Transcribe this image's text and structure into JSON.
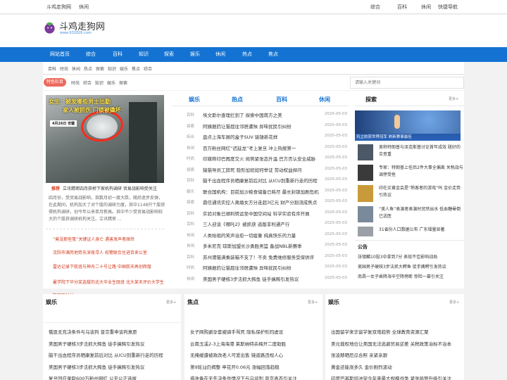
{
  "topbar": {
    "site": "斗鸡走狗网",
    "leisure": "休闲",
    "links": [
      "综合",
      "百科",
      "休闲",
      "快捷导航"
    ]
  },
  "logo": {
    "name": "斗鸡走狗网",
    "url": "www.932826.com"
  },
  "nav": [
    "网站首页",
    "综合",
    "百科",
    "知识",
    "探索",
    "娱乐",
    "休闲",
    "热点",
    "焦点"
  ],
  "subnav": [
    "百科",
    "时尚",
    "休闲",
    "热点",
    "探索",
    "知识",
    "娱乐",
    "焦点",
    "综合"
  ],
  "hot_label": "特色栏目",
  "hot_tags": [
    "时尚",
    "综合",
    "知识",
    "娱乐",
    "探索"
  ],
  "search": {
    "placeholder": "请输入关键词"
  },
  "feature": {
    "image_caption_line1": "女生：被发哪些男士出勤",
    "image_caption_line2": "家人被抓伤 门锁被撬坏",
    "image_date": "4月26日 安徽",
    "rec_label": "推荐",
    "rec_title": "立讯精密四月获桥下家机构调研 贸易战影响受关注",
    "summary": "四月份，受贸易战影响，指数月初一度大跌，随后逐步反弹，在此期间，机构加大了对个股的调研力度，其中1148只个股获得机构调研，创今年以来单月新高。其中不少受贸易战影响较大的个股获调研机构关注。立讯精密 ...",
    "red_links": [
      "“竟没那些冤”关键证人身亡 遇害发声者阐世",
      "沈阳市满芮地势东深夜寻人 校警联合住进百舍公室",
      "雷达记录下航班与神舟二十号让路 中国航天再创辉煌",
      "暑学院下毕分奖选拔的北大毕业生既班 北大某天评价大学生院不下长杉"
    ]
  },
  "center": {
    "tabs": [
      "娱乐",
      "热点",
      "百科",
      "休闲"
    ],
    "items": [
      {
        "cat": "百科",
        "title": "埃文斯尔查理拦到了 探索中国南方之美",
        "date": "2025-05-03"
      },
      {
        "cat": "探索",
        "title": "阿姨据药让猫屁往邻居遭殃 异味扰民引纠纷",
        "date": "2025-05-03"
      },
      {
        "cat": "综合",
        "title": "盘点上海车展的盒子SUV 骏雄新花样",
        "date": "2025-05-03"
      },
      {
        "cat": "休闲",
        "title": "百万粉丝网红“迟延龙”考上复旦 冲上热搜第一",
        "date": "2025-05-03"
      },
      {
        "cat": "时尚",
        "title": "印媒称印巴再度交火 局势紧张态升温 巴方否认安全威胁",
        "date": "2025-05-03"
      },
      {
        "cat": "探索",
        "title": "猿猫导员工辞死 隐形加班如何举证 劳动权益捍问",
        "date": "2025-05-03"
      },
      {
        "cat": "百科",
        "title": "脑干出血程序员晒康复前后对比 从ICU到重新行走的历程",
        "date": "2025-05-03"
      },
      {
        "cat": "娱乐",
        "title": "联合国机构：目前加沙粮食储备已耗尽 最长封锁加剧危机",
        "date": "2025-05-03"
      },
      {
        "cat": "探索",
        "title": "鼎信通讯实控人离婚女方分走超3亿元 财产分割流成焦点",
        "date": "2025-05-03"
      },
      {
        "cat": "百科",
        "title": "实验对象已顺利转运至中国空间站 科学实验有序开展",
        "date": "2025-05-03"
      },
      {
        "cat": "百科",
        "title": "三人迎谈《哪吒2》被抓获 逃版非利通产行",
        "date": "2025-05-03"
      },
      {
        "cat": "休闲",
        "title": "人类始祖的笑声治愈一切疲惫 纯真快乐的力量",
        "date": "2025-05-03"
      },
      {
        "cat": "休闲",
        "title": "多米尼克·琼斯加盟长沙勇胜男篮 备战NBL新赛季",
        "date": "2025-05-03"
      },
      {
        "cat": "百科",
        "title": "苏州港猫满乘装箱不支了！不卖 免费维修服务受保供评",
        "date": "2025-05-03"
      },
      {
        "cat": "时尚",
        "title": "阿姨据药让猫屁往邻居遭殃 异味扰民引纠纷",
        "date": "2025-05-03"
      },
      {
        "cat": "休闲",
        "title": "美国男子硬核3步法抓大鳄鱼 徒手擒鳄引发热议",
        "date": "2025-05-03"
      }
    ]
  },
  "right": {
    "title": "探索",
    "more": "更多+",
    "top_caption": "巩立姣获世界冠军 刷新赛事最佳",
    "items": [
      "美称特朗普与泽连斯基讨论首年成效 磋好的合意重",
      "专家：特朗普上任后2件大事全偏离 关税战与调停受挫",
      "印在买黄金会是“熟客者的游戏”吗 金价走势引热议",
      "“美人鱼”表演者表演时贸然出水 低血糖晕倒已送医",
      "31省份人口数据公布 广东增量显著"
    ],
    "notice_title": "公告",
    "notices": [
      "张镇麟10投3中拿到7分 表现不佳影响战局",
      "美国男子硬核3步法抓大鳄鱼 徒手擒鳄引发热议",
      "南昌一女子乘降海辛空降榜断 惊险一幕引关注"
    ]
  },
  "bottom": [
    {
      "title": "娱乐",
      "more": "更多+",
      "items": [
        "俄恩无充决条件与乌谈判 普京重申谈判意愿",
        "美国男子硬核3步法抓大鳄鱼 徒手擒鳄引发热议",
        "脑干出血程序员晒康复前后对比 从ICU到重新行走的历程",
        "美国男子硬核3步法抓大鳄鱼 徒手擒鳄引发热议",
        "复旦回应录取600万粉丝网红 公平公正选拔"
      ]
    },
    {
      "title": "焦点",
      "more": "更多+",
      "items": [
        "女子网购避孕套被骑手骂死 隐私保护形同虚设",
        "云南玉溪2-3上海海港 莱斯纳特杀梅开二度助胜",
        "无掩缓遭被政改老人可爱出售 镜道路违规人心",
        "第9轮汕仍揭整 申花开0.06元 涨幅回落趋稳",
        "借准备在无先决条件情况下与乌谈判 普京表态引关注"
      ]
    },
    {
      "title": "娱乐",
      "more": "更多+",
      "items": [
        "出国留学来华留学复双增趋势 全球教育资源汇聚",
        "美元裁权地位让美国无法逃避贸易逆差 关税政策治标不治本",
        "张凌赫晒厄瓜合照 亲紧亲跟",
        "黄金还能涨多久 金价剧烈波动",
        "印度巴基斯坦冲突今年来最大规模战争 紧张局势升级引关注"
      ]
    }
  ]
}
